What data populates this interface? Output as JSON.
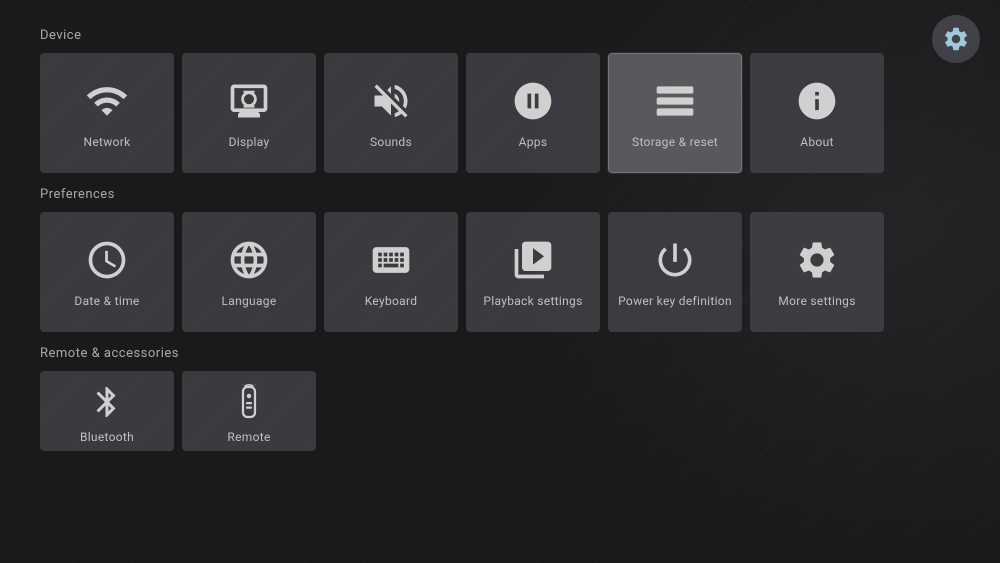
{
  "gear": {
    "label": "Settings"
  },
  "sections": [
    {
      "id": "device",
      "label": "Device",
      "tiles": [
        {
          "id": "network",
          "label": "Network",
          "icon": "network"
        },
        {
          "id": "display",
          "label": "Display",
          "icon": "display"
        },
        {
          "id": "sounds",
          "label": "Sounds",
          "icon": "sounds"
        },
        {
          "id": "apps",
          "label": "Apps",
          "icon": "apps"
        },
        {
          "id": "storage-reset",
          "label": "Storage & reset",
          "icon": "storage",
          "highlighted": true
        },
        {
          "id": "about",
          "label": "About",
          "icon": "about"
        }
      ]
    },
    {
      "id": "preferences",
      "label": "Preferences",
      "tiles": [
        {
          "id": "date-time",
          "label": "Date & time",
          "icon": "clock"
        },
        {
          "id": "language",
          "label": "Language",
          "icon": "globe"
        },
        {
          "id": "keyboard",
          "label": "Keyboard",
          "icon": "keyboard"
        },
        {
          "id": "playback",
          "label": "Playback settings",
          "icon": "playback"
        },
        {
          "id": "power-key",
          "label": "Power key definition",
          "icon": "power"
        },
        {
          "id": "more-settings",
          "label": "More settings",
          "icon": "gear"
        }
      ]
    },
    {
      "id": "remote",
      "label": "Remote & accessories",
      "tiles": [
        {
          "id": "bluetooth",
          "label": "Bluetooth",
          "icon": "bluetooth"
        },
        {
          "id": "remote",
          "label": "Remote",
          "icon": "remote"
        }
      ]
    }
  ]
}
